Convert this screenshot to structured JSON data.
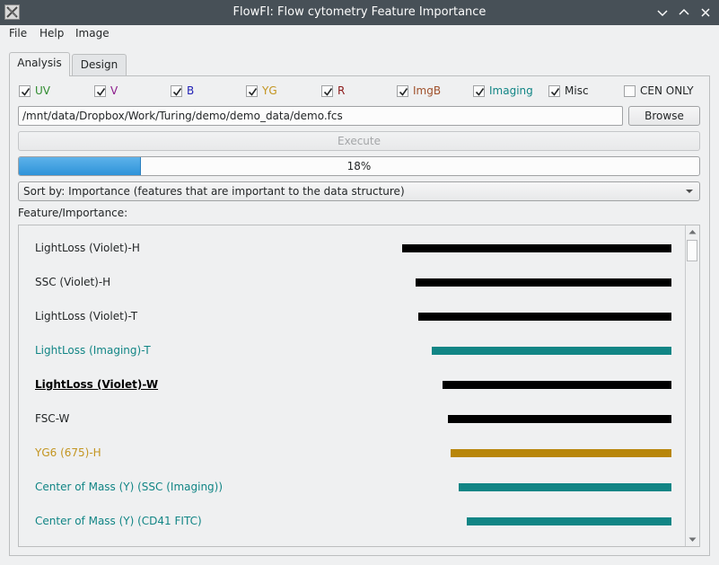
{
  "window": {
    "title": "FlowFI: Flow cytometry Feature Importance"
  },
  "menu": [
    "File",
    "Help",
    "Image"
  ],
  "tabs": [
    {
      "label": "Analysis",
      "active": true
    },
    {
      "label": "Design",
      "active": false
    }
  ],
  "checkboxes": [
    {
      "label": "UV",
      "checked": true,
      "color": "#2e8b2e"
    },
    {
      "label": "V",
      "checked": true,
      "color": "#8b1a8b"
    },
    {
      "label": "B",
      "checked": true,
      "color": "#1f1fb5"
    },
    {
      "label": "YG",
      "checked": true,
      "color": "#c39520"
    },
    {
      "label": "R",
      "checked": true,
      "color": "#8b1a1a"
    },
    {
      "label": "ImgB",
      "checked": true,
      "color": "#a0522d"
    },
    {
      "label": "Imaging",
      "checked": true,
      "color": "#118585"
    },
    {
      "label": "Misc",
      "checked": true,
      "color": "#232627"
    },
    {
      "label": "CEN ONLY",
      "checked": false,
      "color": "#232627"
    }
  ],
  "file_path": "/mnt/data/Dropbox/Work/Turing/demo/demo_data/demo.fcs",
  "buttons": {
    "browse": "Browse",
    "execute": "Execute"
  },
  "progress": {
    "value": 18,
    "text": "18%"
  },
  "sort_combo": "Sort by: Importance (features that are important to the data structure)",
  "feature_label": "Feature/Importance:",
  "features": [
    {
      "name": "LightLoss (Violet)-H",
      "importance": 1.0,
      "color": "#000000",
      "text_color": "#232627",
      "bold": false
    },
    {
      "name": "SSC (Violet)-H",
      "importance": 0.95,
      "color": "#000000",
      "text_color": "#232627",
      "bold": false
    },
    {
      "name": "LightLoss (Violet)-T",
      "importance": 0.94,
      "color": "#000000",
      "text_color": "#232627",
      "bold": false
    },
    {
      "name": "LightLoss (Imaging)-T",
      "importance": 0.89,
      "color": "#118585",
      "text_color": "#118585",
      "bold": false
    },
    {
      "name": "LightLoss (Violet)-W",
      "importance": 0.85,
      "color": "#000000",
      "text_color": "#000000",
      "bold": true
    },
    {
      "name": "FSC-W",
      "importance": 0.83,
      "color": "#000000",
      "text_color": "#232627",
      "bold": false
    },
    {
      "name": "YG6 (675)-H",
      "importance": 0.82,
      "color": "#b8860b",
      "text_color": "#c39520",
      "bold": false
    },
    {
      "name": "Center of Mass (Y) (SSC (Imaging))",
      "importance": 0.79,
      "color": "#118585",
      "text_color": "#118585",
      "bold": false
    },
    {
      "name": "Center of Mass (Y) (CD41 FITC)",
      "importance": 0.76,
      "color": "#118585",
      "text_color": "#118585",
      "bold": false
    }
  ]
}
